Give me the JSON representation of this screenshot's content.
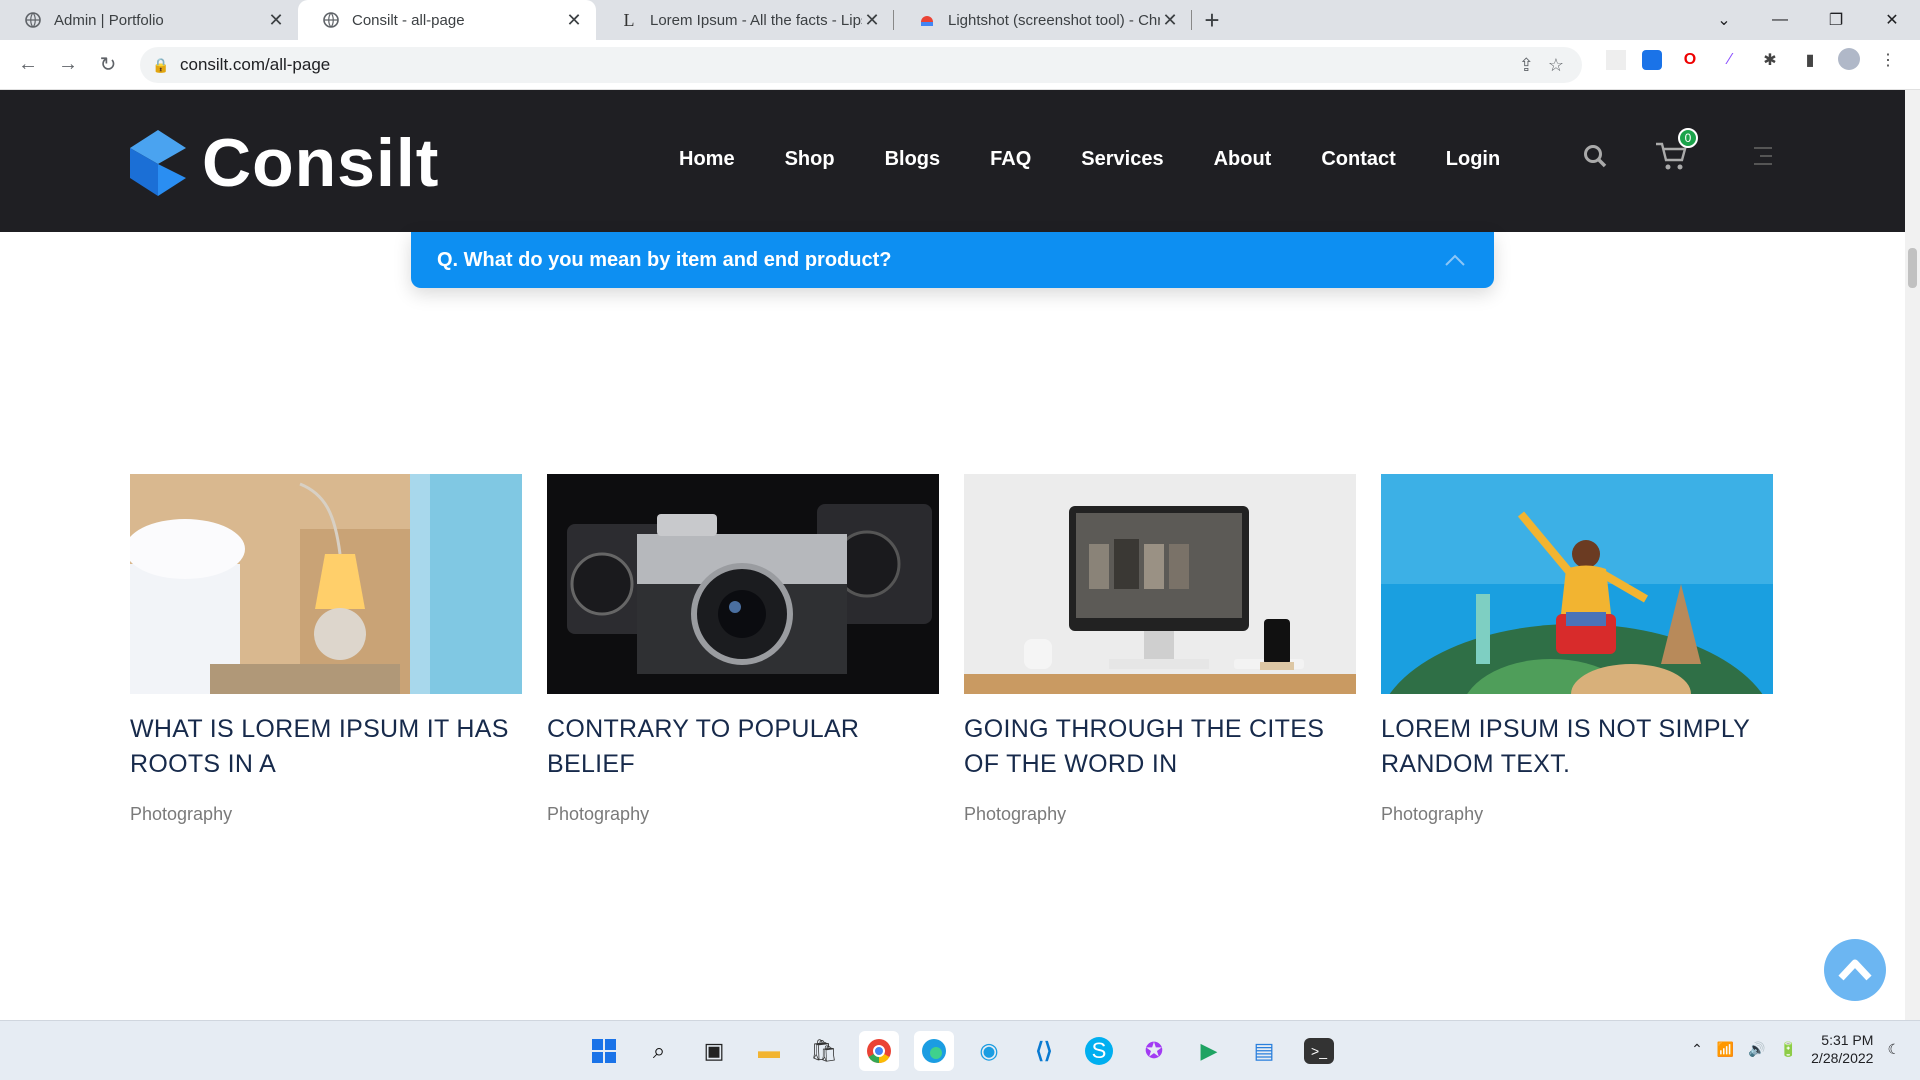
{
  "browser": {
    "tabs": [
      {
        "title": "Admin | Portfolio",
        "active": false
      },
      {
        "title": "Consilt - all-page",
        "active": true
      },
      {
        "title": "Lorem Ipsum - All the facts - Lips",
        "active": false
      },
      {
        "title": "Lightshot (screenshot tool) - Chr",
        "active": false
      }
    ],
    "url": "consilt.com/all-page"
  },
  "site": {
    "logo_text": "Consilt",
    "nav": [
      "Home",
      "Shop",
      "Blogs",
      "FAQ",
      "Services",
      "About",
      "Contact",
      "Login"
    ],
    "cart_count": "0",
    "brand_color": "#0d8ff2"
  },
  "faq": {
    "question": "Q. What do you mean by item and end product?"
  },
  "cards": [
    {
      "title": "WHAT IS LOREM IPSUM IT HAS ROOTS IN A",
      "category": "Photography"
    },
    {
      "title": "CONTRARY TO POPULAR BELIEF",
      "category": "Photography"
    },
    {
      "title": "GOING THROUGH THE CITES OF THE WORD IN",
      "category": "Photography"
    },
    {
      "title": "LOREM IPSUM IS NOT SIMPLY RANDOM TEXT.",
      "category": "Photography"
    }
  ],
  "taskbar": {
    "time": "5:31 PM",
    "date": "2/28/2022"
  }
}
